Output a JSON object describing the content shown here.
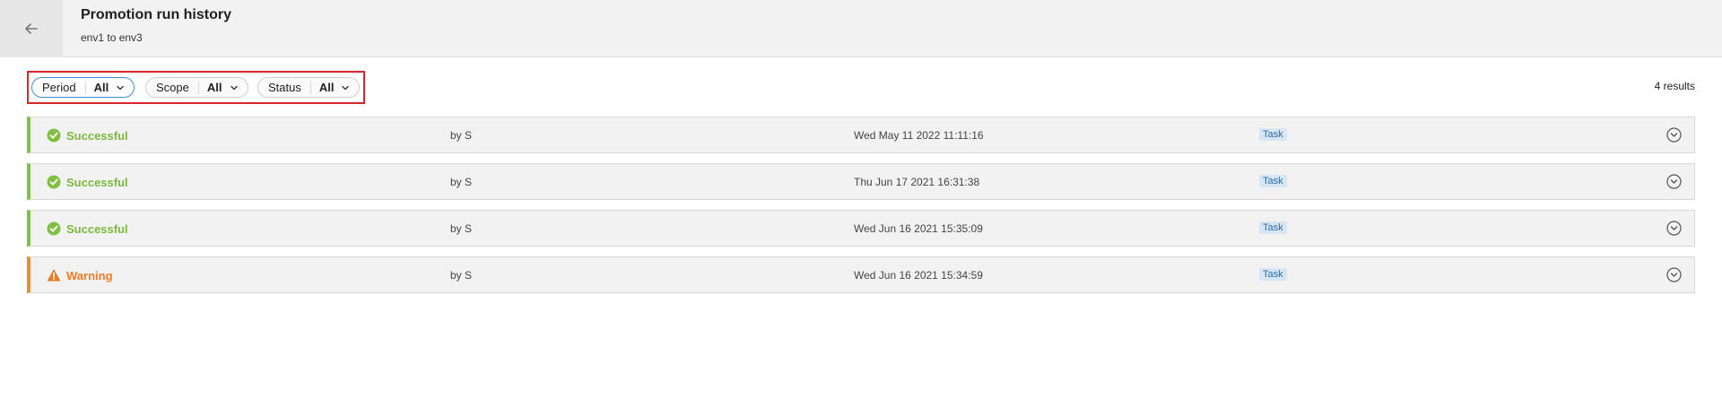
{
  "header": {
    "title": "Promotion run history",
    "subtitle": "env1 to env3",
    "back_icon": "arrow-left-icon"
  },
  "filters": [
    {
      "label": "Period",
      "value": "All"
    },
    {
      "label": "Scope",
      "value": "All"
    },
    {
      "label": "Status",
      "value": "All"
    }
  ],
  "results_count": "4 results",
  "colors": {
    "success": "#80c144",
    "warning": "#ef8a2d",
    "highlight_box": "#d6262e",
    "active_filter": "#3e8ed6"
  },
  "runs": [
    {
      "status": "Successful",
      "status_icon": "check-circle-icon",
      "by": "by S",
      "date": "Wed May 11 2022 11:11:16",
      "badge": "Task"
    },
    {
      "status": "Successful",
      "status_icon": "check-circle-icon",
      "by": "by S",
      "date": "Thu Jun 17 2021 16:31:38",
      "badge": "Task"
    },
    {
      "status": "Successful",
      "status_icon": "check-circle-icon",
      "by": "by S",
      "date": "Wed Jun 16 2021 15:35:09",
      "badge": "Task"
    },
    {
      "status": "Warning",
      "status_icon": "warning-triangle-icon",
      "by": "by S",
      "date": "Wed Jun 16 2021 15:34:59",
      "badge": "Task"
    }
  ]
}
